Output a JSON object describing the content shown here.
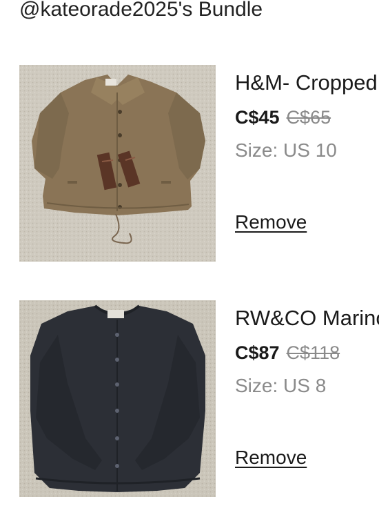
{
  "bundle": {
    "title": "@kateorade2025's Bundle"
  },
  "items": [
    {
      "title": "H&M- Cropped",
      "price": "C$45",
      "original_price": "C$65",
      "size": "Size: US 10",
      "remove_label": "Remove",
      "image_description": "tan cropped jacket"
    },
    {
      "title": "RW&CO Marino",
      "price": "C$87",
      "original_price": "C$118",
      "size": "Size: US 8",
      "remove_label": "Remove",
      "image_description": "dark charcoal cardigan"
    }
  ],
  "colors": {
    "text": "#1a1a1a",
    "muted": "#8a8a8a",
    "carpet": "#cdc8bd",
    "jacket": "#8a7456",
    "cardigan": "#2c2f36"
  }
}
